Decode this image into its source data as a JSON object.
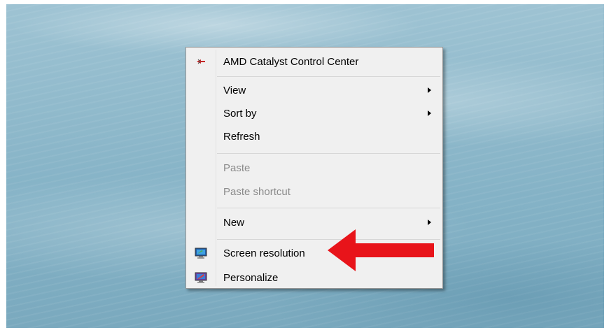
{
  "context_menu": {
    "items": [
      {
        "label": "AMD Catalyst Control Center",
        "icon": "amd-icon",
        "enabled": true
      },
      {
        "label": "View",
        "submenu": true,
        "enabled": true
      },
      {
        "label": "Sort by",
        "submenu": true,
        "enabled": true
      },
      {
        "label": "Refresh",
        "enabled": true
      },
      {
        "label": "Paste",
        "enabled": false
      },
      {
        "label": "Paste shortcut",
        "enabled": false
      },
      {
        "label": "New",
        "submenu": true,
        "enabled": true
      },
      {
        "label": "Screen resolution",
        "icon": "screen-resolution-icon",
        "enabled": true
      },
      {
        "label": "Personalize",
        "icon": "personalize-icon",
        "enabled": true
      }
    ]
  },
  "annotation": {
    "type": "red-arrow",
    "points_to": "Screen resolution",
    "color": "#e8141a"
  },
  "colors": {
    "menu_bg": "#f0f0f0",
    "menu_border": "#979797",
    "disabled_text": "#8a8a8a"
  }
}
